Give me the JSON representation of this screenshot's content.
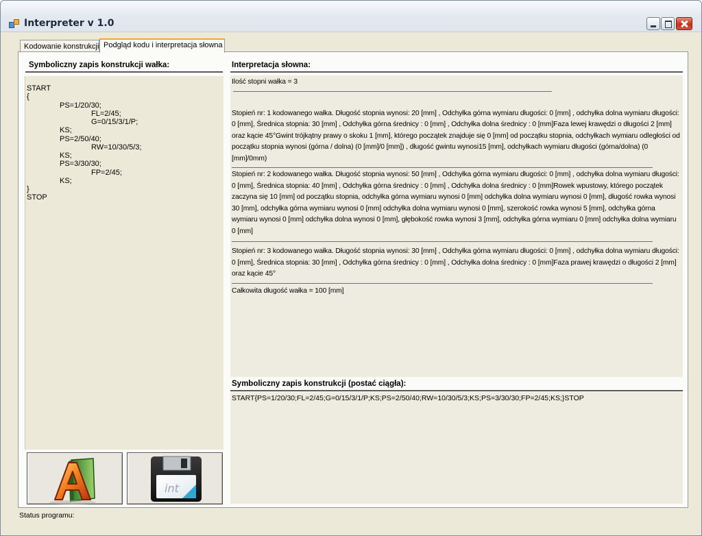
{
  "window": {
    "title": "Interpreter v 1.0"
  },
  "tabs": [
    {
      "label": "Kodowanie konstrukcji",
      "active": false
    },
    {
      "label": "Podgląd kodu i interpretacja słowna",
      "active": true
    }
  ],
  "left_panel": {
    "heading": "Symboliczny zapis konstrukcji wałka:",
    "code_lines": [
      "START",
      "{",
      "PS=1/20/30;",
      "FL=2/45;",
      "G=0/15/3/1/P;",
      "KS;",
      "PS=2/50/40;",
      "RW=10/30/5/3;",
      "KS;",
      "PS=3/30/30;",
      "FP=2/45;",
      "KS;",
      "}",
      "STOP"
    ]
  },
  "interpretation": {
    "heading": "Interpretacja słowna:",
    "header_line": "Ilość stopni wałka = 3",
    "steps": [
      "Stopień nr: 1 kodowanego wałka. Długość stopnia wynosi: 20 [mm] , Odchyłka górna wymiaru długości: 0 [mm] , odchyłka dolna wymiaru długości: 0 [mm], Średnica stopnia: 30 [mm] , Odchyłka górna średnicy : 0 [mm] , Odchyłka dolna średnicy : 0 [mm]Faza lewej krawędzi o długości 2 [mm] oraz kącie 45°Gwint trójkątny prawy o skoku 1 [mm], którego początek znajduje się 0 [mm] od początku stopnia, odchyłkach wymiaru odległości od początku stopnia wynosi (górna / dolna) (0 [mm]/0 [mm]) , długość gwintu wynosi15 [mm], odchyłkach wymiaru długości (górna/dolna) (0 [mm]/0mm)",
      "Stopień nr: 2 kodowanego wałka. Długość stopnia wynosi: 50 [mm] , Odchyłka górna wymiaru długości: 0 [mm] , odchyłka dolna wymiaru długości: 0 [mm], Średnica stopnia: 40 [mm] , Odchyłka górna średnicy : 0 [mm] , Odchyłka dolna średnicy : 0 [mm]Rowek wpustowy, którego początek zaczyna się 10 [mm] od początku stopnia, odchyłka górna wymiaru wynosi 0 [mm] odchyłka dolna wymiaru wynosi 0 [mm], długość rowka wynosi 30 [mm], odchyłka górna wymiaru wynosi 0 [mm] odchyłka dolna wymiaru wynosi 0 [mm], szerokość rowka wynosi 5 [mm], odchyłka górna wymiaru wynosi 0 [mm] odchyłka dolna wynosi 0 [mm], głębokość rowka wynosi 3 [mm], odchyłka górna wymiaru 0 [mm] odchyłka dolna wymiaru 0 [mm]",
      "Stopień nr: 3 kodowanego wałka. Długość stopnia wynosi: 30 [mm] , Odchyłka górna wymiaru długości: 0 [mm] , odchyłka dolna wymiaru długości: 0 [mm], Średnica stopnia: 30 [mm] , Odchyłka górna średnicy : 0 [mm] , Odchyłka dolna średnicy : 0 [mm]Faza prawej krawędzi o długości 2 [mm] oraz kącie 45°"
    ],
    "footer_line": "Całkowita długość wałka = 100 [mm]"
  },
  "continuous": {
    "heading": "Symboliczny zapis konstrukcji (postać ciągła):",
    "text": "START{PS=1/20/30;FL=2/45;G=0/15/3/1/P;KS;PS=2/50/40;RW=10/30/5/3;KS;PS=3/30/30;FP=2/45;KS;}STOP"
  },
  "buttons": {
    "font_icon": "font-letter-a-icon",
    "save_icon": "floppy-disk-int-icon",
    "save_badge": "int"
  },
  "status": {
    "label": "Status programu:"
  },
  "colors": {
    "active_tab_accent": "#f4a62b",
    "close_button": "#c3321b"
  }
}
